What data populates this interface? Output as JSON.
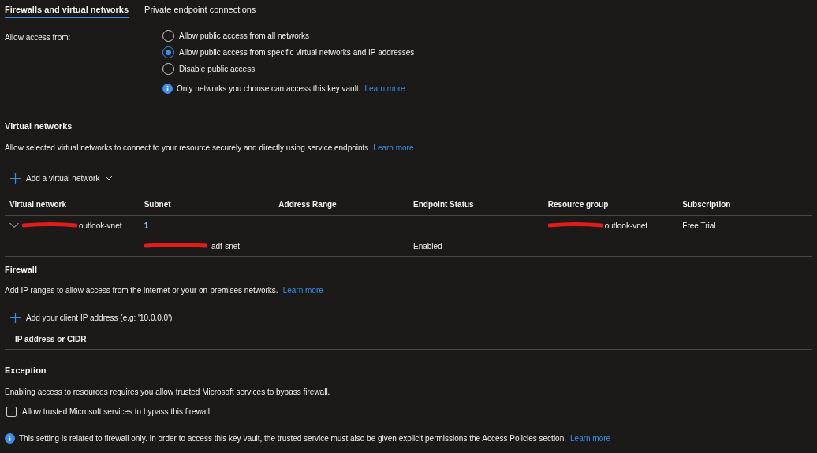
{
  "tabs": [
    {
      "label": "Firewalls and virtual networks",
      "selected": true
    },
    {
      "label": "Private endpoint connections",
      "selected": false
    }
  ],
  "access": {
    "label": "Allow access from:",
    "options": [
      {
        "label": "Allow public access from all networks",
        "selected": false
      },
      {
        "label": "Allow public access from specific virtual networks and IP addresses",
        "selected": true
      },
      {
        "label": "Disable public access",
        "selected": false
      }
    ],
    "info": "Only networks you choose can access this key vault.",
    "info_link": "Learn more"
  },
  "virtual_networks": {
    "title": "Virtual networks",
    "description": "Allow selected virtual networks to connect to your resource securely and directly using service endpoints",
    "link": "Learn more",
    "add_button": "Add a virtual network",
    "columns": [
      "Virtual network",
      "Subnet",
      "Address Range",
      "Endpoint Status",
      "Resource group",
      "Subscription"
    ],
    "rows": [
      {
        "expanded": true,
        "redacted": true,
        "cells": [
          "outlook-vnet",
          "1",
          "",
          "",
          "outlook-vnet",
          "Free Trial"
        ]
      },
      {
        "redacted": true,
        "cells": [
          "",
          "-adf-snet",
          "",
          "Enabled",
          "",
          ""
        ]
      }
    ]
  },
  "firewall": {
    "title": "Firewall",
    "description": "Add IP ranges to allow access from the internet or your on-premises networks.",
    "link": "Learn more",
    "add_button": "Add your client IP address (e.g: '10.0.0.0')",
    "column": "IP address or CIDR"
  },
  "exception": {
    "title": "Exception",
    "description": "Enabling access to resources requires you allow trusted Microsoft services to bypass firewall.",
    "checkbox": {
      "label": "Allow trusted Microsoft services to bypass this firewall",
      "checked": false
    },
    "info": "This setting is related to firewall only. In order to access this key vault, the trusted service must also be given explicit permissions the Access Policies section.",
    "info_link": "Learn more"
  }
}
